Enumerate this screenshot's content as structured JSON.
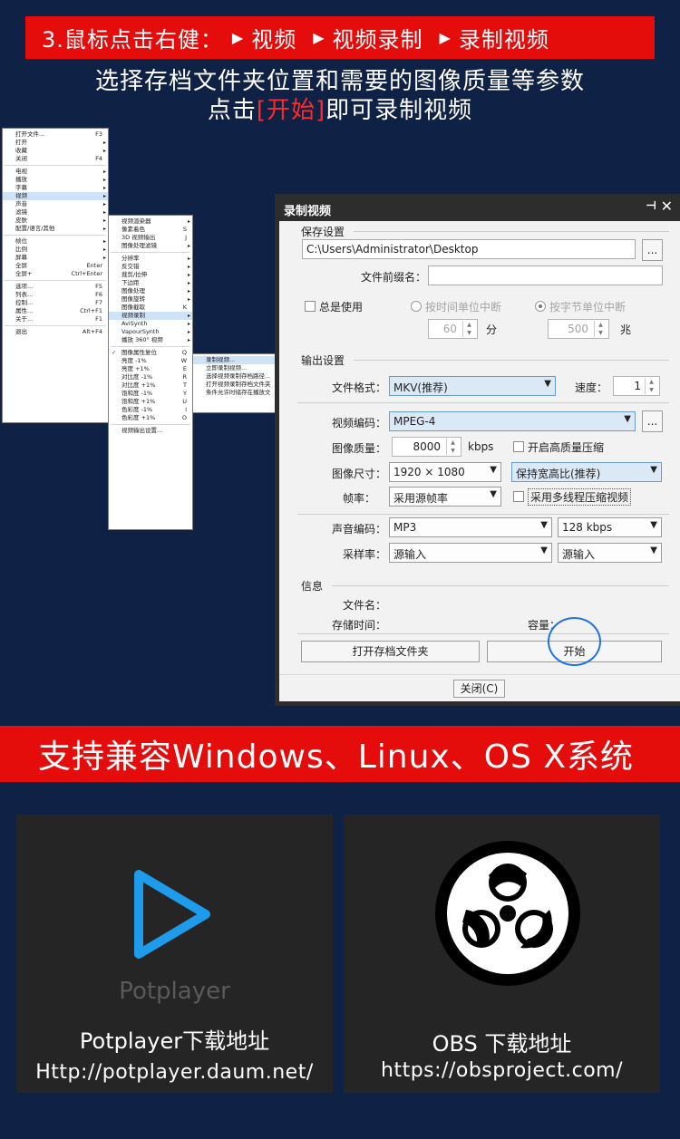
{
  "banner": {
    "step": "3.鼠标点击右健：",
    "crumb_1": "视频",
    "crumb_2": "视频录制",
    "crumb_3": "录制视频"
  },
  "intro": {
    "line1": "选择存档文件夹位置和需要的图像质量等参数",
    "line2_pre": "点击",
    "line2_hl": "[开始]",
    "line2_post": "即可录制视频"
  },
  "menu": {
    "main": [
      {
        "label": "打开文件...",
        "key": "F3"
      },
      {
        "label": "打开",
        "sub": true
      },
      {
        "label": "收藏",
        "sub": true
      },
      {
        "label": "关闭",
        "key": "F4"
      },
      {
        "sep": true
      },
      {
        "label": "电视",
        "sub": true
      },
      {
        "label": "播放",
        "sub": true
      },
      {
        "label": "字幕",
        "sub": true
      },
      {
        "label": "视频",
        "sub": true,
        "selected": true
      },
      {
        "label": "声音",
        "sub": true
      },
      {
        "label": "滤镜",
        "sub": true
      },
      {
        "label": "皮肤",
        "sub": true
      },
      {
        "label": "配置/语言/其他",
        "sub": true
      },
      {
        "sep": true
      },
      {
        "label": "帧位",
        "sub": true
      },
      {
        "label": "比例",
        "sub": true
      },
      {
        "label": "屏幕",
        "sub": true
      },
      {
        "label": "全屏",
        "key": "Enter"
      },
      {
        "label": "全屏+",
        "key": "Ctrl+Enter"
      },
      {
        "sep": true
      },
      {
        "label": "选项...",
        "key": "F5"
      },
      {
        "label": "列表...",
        "key": "F6"
      },
      {
        "label": "控制...",
        "key": "F7"
      },
      {
        "label": "属性...",
        "key": "Ctrl+F1"
      },
      {
        "label": "关于...",
        "key": "F1"
      },
      {
        "sep": true
      },
      {
        "label": "退出",
        "key": "Alt+F4"
      }
    ],
    "video": [
      {
        "label": "视频渲染器",
        "sub": true
      },
      {
        "label": "像素着色",
        "key": "S"
      },
      {
        "label": "3D 视频输出",
        "key": "J"
      },
      {
        "label": "图像处理滤镜",
        "sub": true
      },
      {
        "sep": true
      },
      {
        "label": "分辨率",
        "sub": true
      },
      {
        "label": "反交错",
        "sub": true
      },
      {
        "label": "裁剪/拉伸",
        "sub": true
      },
      {
        "label": "下边距",
        "sub": true
      },
      {
        "label": "图像处理",
        "sub": true
      },
      {
        "label": "图像旋转",
        "sub": true
      },
      {
        "label": "图像截取",
        "key": "K"
      },
      {
        "label": "视频录制",
        "sub": true,
        "selected": true
      },
      {
        "label": "AviSynth",
        "sub": true
      },
      {
        "label": "VapourSynth",
        "sub": true
      },
      {
        "label": "播放 360° 视频",
        "sub": true
      },
      {
        "sep": true
      },
      {
        "label": "图像属性复位",
        "key": "Q",
        "checked": true
      },
      {
        "label": "亮度 -1%",
        "key": "W"
      },
      {
        "label": "亮度 +1%",
        "key": "E"
      },
      {
        "label": "对比度 -1%",
        "key": "R"
      },
      {
        "label": "对比度 +1%",
        "key": "T"
      },
      {
        "label": "饱和度 -1%",
        "key": "Y"
      },
      {
        "label": "饱和度 +1%",
        "key": "U"
      },
      {
        "label": "色彩度 -1%",
        "key": "I"
      },
      {
        "label": "色彩度 +1%",
        "key": "O"
      },
      {
        "sep": true
      },
      {
        "label": "视频输出设置..."
      }
    ],
    "record": [
      {
        "label": "录制视频...",
        "selected": true
      },
      {
        "label": "立即录制视频..."
      },
      {
        "label": "选择视频录制存档路径..."
      },
      {
        "label": "打开视频录制存档文件夹"
      },
      {
        "label": "条件允许时储存在播放文"
      }
    ]
  },
  "dialog": {
    "title": "录制视频",
    "save_group": "保存设置",
    "path": "C:\\Users\\Administrator\\Desktop",
    "browse": "...",
    "prefix_label": "文件前缀名：",
    "prefix_value": "",
    "total_use": "总是使用",
    "split_time": "按时间单位中断",
    "split_bytes": "按字节单位中断",
    "time_value": "60",
    "time_unit": "分",
    "bytes_value": "500",
    "bytes_unit": "兆",
    "output_group": "输出设置",
    "format_label": "文件格式：",
    "format_value": "MKV(推荐)",
    "speed_label": "速度：",
    "speed_value": "1",
    "vcodec_label": "视频编码：",
    "vcodec_value": "MPEG-4",
    "quality_label": "图像质量：",
    "quality_value": "8000",
    "quality_unit": "kbps",
    "hq_compress": "开启高质量压缩",
    "size_label": "图像尺寸：",
    "size_value": "1920 × 1080",
    "aspect_value": "保持宽高比(推荐)",
    "fps_label": "帧率：",
    "fps_value": "采用源帧率",
    "multithread": "采用多线程压缩视频",
    "acodec_label": "声音编码：",
    "acodec_value": "MP3",
    "abitrate_value": "128 kbps",
    "samplerate_label": "采样率：",
    "samplerate_value": "源输入",
    "channels_value": "源输入",
    "info_group": "信息",
    "filename_label": "文件名：",
    "savetime_label": "存储时间：",
    "capacity_label": "容量：",
    "open_folder": "打开存档文件夹",
    "start": "开始",
    "close": "关闭(C)"
  },
  "os_banner": "支持兼容Windows、Linux、OS X系统",
  "cards": {
    "potplayer": {
      "brand": "Potplayer",
      "title": "Potplayer下载地址",
      "url": "Http://potplayer.daum.net/"
    },
    "obs": {
      "title": "OBS 下载地址",
      "url": "https://obsproject.com/"
    }
  },
  "colors": {
    "background": "#0f2145",
    "accent_red": "#e50c0c",
    "potplayer_blue": "#1e9bea",
    "highlight_ring": "#1f73e0"
  }
}
